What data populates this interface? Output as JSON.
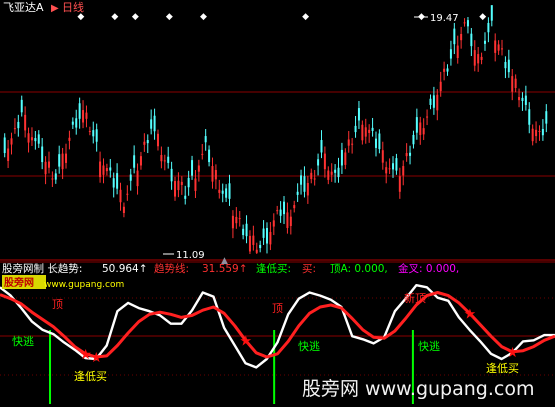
{
  "title": "飞亚达A",
  "period": "日线",
  "watermark": "股旁网 www.gupang.com",
  "site_mark": "股旁网\nwww.gupang.com",
  "indicator_name": "股旁网制 长趋势:",
  "indicator_value": "50.964↑",
  "trend_label": "趋势线:",
  "trend_value": "31.559↑",
  "buy_label": "逢低买:",
  "buy_unit": "买:",
  "top_label": "顶A: 0.000,",
  "gold_label": "金叉: 0.000,",
  "annotations": {
    "top_mark": "顶",
    "escape": "快逃",
    "buy_low": "逢低买",
    "new_top": "新顶"
  },
  "colors": {
    "up_candle": "#ff3232",
    "down_candle": "#54ffff",
    "trend_white": "#ffffff",
    "trend_red": "#ff2020",
    "signal_green": "#00ff00",
    "grid": "#b00000",
    "label_yellow": "#ffff00"
  },
  "chart_data": [
    {
      "type": "candlestick",
      "title": "飞亚达A 日线",
      "high_label": "19.47",
      "low_label": "11.09",
      "price_high": 19.47,
      "price_low": 11.09,
      "closes": [
        14.9,
        15.3,
        16.1,
        15.6,
        15.0,
        14.5,
        14.2,
        13.8,
        14.4,
        15.2,
        15.8,
        16.1,
        15.6,
        14.9,
        14.3,
        13.8,
        13.4,
        13.0,
        13.6,
        14.2,
        14.9,
        15.6,
        15.1,
        14.4,
        13.9,
        13.6,
        13.2,
        13.7,
        14.3,
        14.8,
        14.2,
        13.6,
        13.0,
        12.6,
        12.2,
        11.8,
        11.5,
        11.3,
        11.7,
        12.2,
        12.6,
        12.4,
        12.9,
        13.3,
        13.6,
        14.0,
        14.6,
        14.2,
        13.8,
        14.3,
        14.9,
        15.4,
        15.9,
        15.4,
        15.0,
        14.6,
        14.2,
        13.8,
        14.2,
        14.8,
        15.3,
        15.7,
        16.2,
        16.8,
        17.4,
        18.0,
        18.7,
        19.2,
        18.6,
        18.0,
        18.6,
        19.1,
        18.5,
        17.9,
        17.3,
        16.8,
        16.2,
        15.6,
        15.2,
        15.7
      ],
      "buy_signal_positions": [
        11,
        16,
        19,
        24,
        29,
        44,
        61,
        70
      ]
    },
    {
      "type": "line",
      "series": [
        {
          "name": "长趋势",
          "color": "white",
          "values": [
            93,
            85,
            73,
            60,
            52,
            48,
            40,
            33,
            25,
            24,
            37,
            70,
            78,
            73,
            70,
            66,
            58,
            58,
            71,
            88,
            84,
            54,
            37,
            20,
            16,
            24,
            40,
            67,
            82,
            88,
            85,
            81,
            74,
            46,
            43,
            39,
            45,
            70,
            82,
            95,
            93,
            83,
            80,
            64,
            52,
            41,
            29,
            24,
            30,
            41,
            42,
            47,
            47
          ]
        },
        {
          "name": "趋势线",
          "color": "red",
          "values": [
            86,
            82,
            77,
            69,
            62,
            55,
            46,
            36,
            29,
            26,
            27,
            37,
            49,
            60,
            67,
            69,
            67,
            64,
            66,
            71,
            74,
            68,
            56,
            42,
            30,
            26,
            29,
            41,
            56,
            68,
            74,
            76,
            73,
            63,
            52,
            45,
            44,
            51,
            63,
            76,
            85,
            88,
            85,
            78,
            68,
            57,
            46,
            36,
            31,
            32,
            36,
            42,
            46
          ]
        }
      ],
      "escape_signals": [
        3,
        24,
        37
      ],
      "buy_low_signals": [
        8,
        9,
        23,
        44,
        48
      ],
      "ylim": [
        0,
        100
      ]
    }
  ]
}
